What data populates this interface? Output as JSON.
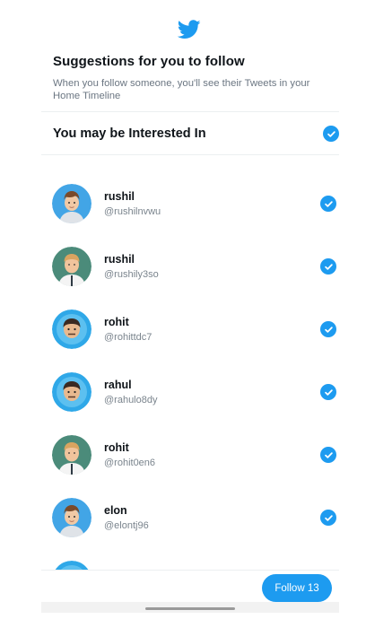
{
  "app": {
    "logo_icon": "twitter-bird-icon",
    "accent": "#1d9bf0"
  },
  "header": {
    "title": "Suggestions for you to follow",
    "subtitle": "When you follow someone, you'll see their Tweets in your Home Timeline"
  },
  "section": {
    "title": "You may be Interested In",
    "checked": true
  },
  "suggestions": [
    {
      "name": "rushil",
      "handle": "@rushilnvwu",
      "avatar": "avatar-boy-blue",
      "checked": true
    },
    {
      "name": "rushil",
      "handle": "@rushily3so",
      "avatar": "avatar-man-green",
      "checked": true
    },
    {
      "name": "rohit",
      "handle": "@rohittdc7",
      "avatar": "avatar-man-blue",
      "checked": true
    },
    {
      "name": "rahul",
      "handle": "@rahulo8dy",
      "avatar": "avatar-man-blue",
      "checked": true
    },
    {
      "name": "rohit",
      "handle": "@rohit0en6",
      "avatar": "avatar-man-green",
      "checked": true
    },
    {
      "name": "elon",
      "handle": "@elontj96",
      "avatar": "avatar-boy-blue",
      "checked": true
    }
  ],
  "footer": {
    "follow_label": "Follow 13"
  }
}
